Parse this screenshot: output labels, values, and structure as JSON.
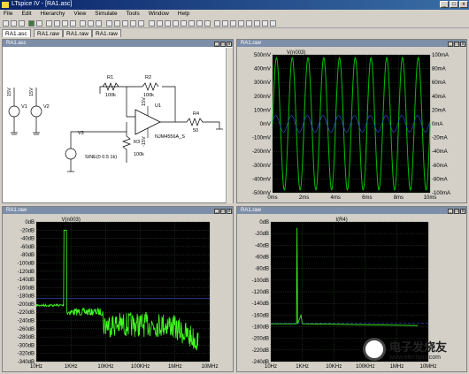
{
  "app": {
    "title": "LTspice IV - [RA1.asc]"
  },
  "window_buttons": {
    "min": "_",
    "max": "□",
    "close": "x"
  },
  "menu": [
    "File",
    "Edit",
    "Hierarchy",
    "View",
    "Simulate",
    "Tools",
    "Window",
    "Help"
  ],
  "tabs": [
    "RA1.asc",
    "RA1.raw",
    "RA1.raw",
    "RA1.raw"
  ],
  "schematic": {
    "title": "RA1.asc",
    "v1_label": "V1",
    "v1_value": "15V",
    "v2_label": "V2",
    "v2_value": "15V",
    "v3_label": "V3",
    "v3_value": "SINE(0 0.5 1k)",
    "r1_label": "R1",
    "r1_value": "100k",
    "r2_label": "R2",
    "r2_value": "100k",
    "r3_label": "R3",
    "r3_value": "100k",
    "r4_label": "R4",
    "r4_value": "50",
    "u1_label": "U1",
    "u1_model": "NJM4556A_S",
    "u1_plus": "15V",
    "u1_minus": "-15V"
  },
  "time_plot": {
    "title": "RA1.raw",
    "trace_name": "V(n003)",
    "left_ticks": [
      "500mV",
      "400mV",
      "300mV",
      "200mV",
      "100mV",
      "0mV",
      "-100mV",
      "-200mV",
      "-300mV",
      "-400mV",
      "-500mV"
    ],
    "right_ticks": [
      "100mA",
      "80mA",
      "60mA",
      "40mA",
      "20mA",
      "0mA",
      "-20mA",
      "-40mA",
      "-60mA",
      "-80mA",
      "-100mA"
    ],
    "x_ticks": [
      "0ms",
      "2ms",
      "4ms",
      "6ms",
      "8ms",
      "10ms"
    ],
    "colors": {
      "bg": "#000000",
      "trace": "#00c000",
      "grid": "#1a4a1a"
    }
  },
  "fft1": {
    "title": "RA1.raw",
    "trace_name": "V(n003)",
    "left_ticks": [
      "0dB",
      "-20dB",
      "-40dB",
      "-60dB",
      "-80dB",
      "-100dB",
      "-120dB",
      "-140dB",
      "-160dB",
      "-180dB",
      "-200dB",
      "-220dB",
      "-240dB",
      "-260dB",
      "-280dB",
      "-300dB",
      "-320dB",
      "-340dB"
    ],
    "x_ticks": [
      "10Hz",
      "1KHz",
      "10KHz",
      "100KHz",
      "1MHz",
      "10MHz"
    ],
    "colors": {
      "trace": "#44ff22"
    }
  },
  "fft2": {
    "title": "RA1.raw",
    "trace_name": "I(R4)",
    "left_ticks": [
      "0dB",
      "-20dB",
      "-40dB",
      "-60dB",
      "-80dB",
      "-100dB",
      "-120dB",
      "-140dB",
      "-160dB",
      "-180dB",
      "-200dB",
      "-220dB",
      "-240dB"
    ],
    "x_ticks": [
      "10Hz",
      "1KHz",
      "10KHz",
      "100KHz",
      "1MHz",
      "10MHz"
    ]
  },
  "watermark": {
    "cn": "电子发烧友",
    "url": "www.elecfans.com"
  }
}
